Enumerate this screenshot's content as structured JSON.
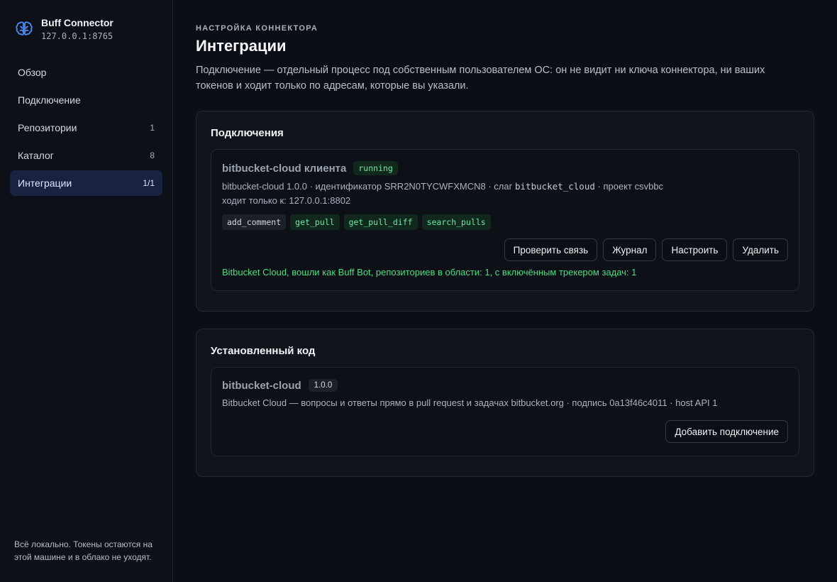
{
  "app": {
    "name": "Buff Connector",
    "address": "127.0.0.1:8765"
  },
  "nav": {
    "items": [
      {
        "label": "Обзор",
        "count": ""
      },
      {
        "label": "Подключение",
        "count": ""
      },
      {
        "label": "Репозитории",
        "count": "1"
      },
      {
        "label": "Каталог",
        "count": "8"
      },
      {
        "label": "Интеграции",
        "count": "1/1"
      }
    ],
    "footer": "Всё локально. Токены остаются на этой машине и в облако не уходят."
  },
  "page": {
    "eyebrow": "НАСТРОЙКА КОННЕКТОРА",
    "title": "Интеграции",
    "description": "Подключение — отдельный процесс под собственным пользователем ОС: он не видит ни ключа коннектора, ни ваших токенов и ходит только по адресам, которые вы указали."
  },
  "connections": {
    "title": "Подключения",
    "item": {
      "name": "bitbucket-cloud клиента",
      "status": "running",
      "meta_prefix": "bitbucket-cloud 1.0.0 · идентификатор SRR2N0TYCWFXMCN8 · слаг",
      "slug": "bitbucket_cloud",
      "meta_suffix": "· проект csvbbc",
      "hosts": "ходит только к: 127.0.0.1:8802",
      "tags": [
        "add_comment",
        "get_pull",
        "get_pull_diff",
        "search_pulls"
      ],
      "buttons": {
        "check": "Проверить связь",
        "log": "Журнал",
        "configure": "Настроить",
        "delete": "Удалить"
      },
      "status_message": "Bitbucket Cloud, вошли как Buff Bot, репозиториев в области: 1, с включённым трекером задач: 1"
    }
  },
  "installed": {
    "title": "Установленный код",
    "item": {
      "name": "bitbucket-cloud",
      "version": "1.0.0",
      "description": "Bitbucket Cloud — вопросы и ответы прямо в pull request и задачах bitbucket.org · подпись 0a13f46c4011 · host API 1",
      "add_button": "Добавить подключение"
    }
  },
  "colors": {
    "accent": "#4a8cf5",
    "success": "#4ade80",
    "background": "#0b0e14"
  }
}
